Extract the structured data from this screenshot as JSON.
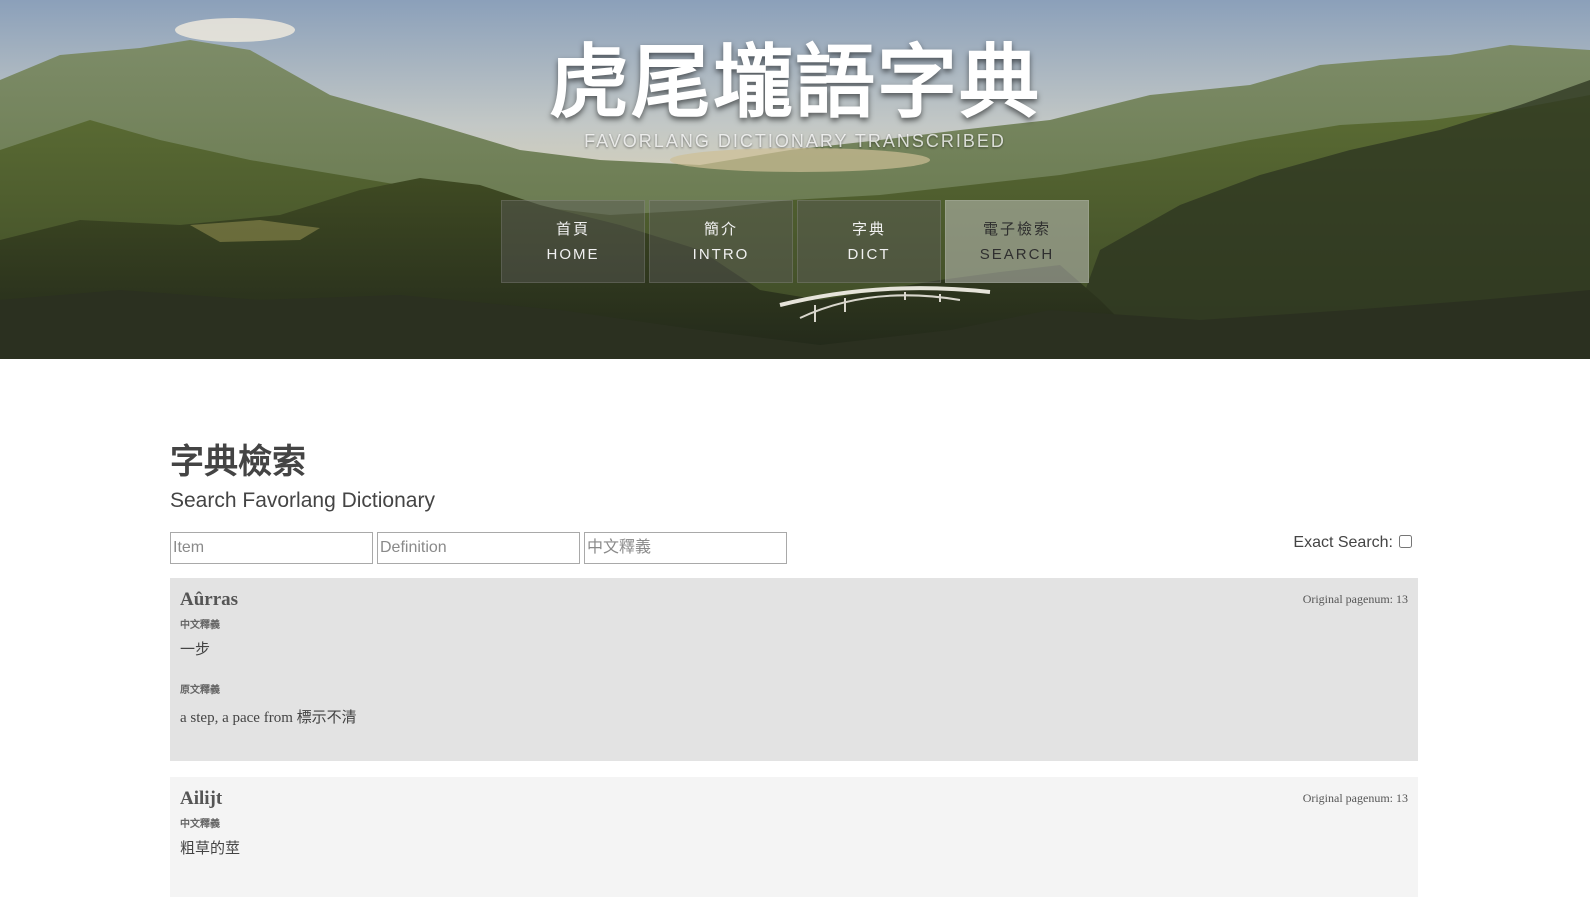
{
  "site": {
    "title": "虎尾壠語字典",
    "subtitle": "FAVORLANG DICTIONARY TRANSCRIBED"
  },
  "nav": [
    {
      "zh": "首頁",
      "en": "HOME",
      "active": false
    },
    {
      "zh": "簡介",
      "en": "INTRO",
      "active": false
    },
    {
      "zh": "字典",
      "en": "DICT",
      "active": false
    },
    {
      "zh": "電子檢索",
      "en": "SEARCH",
      "active": true
    }
  ],
  "page": {
    "title": "字典檢索",
    "subtitle": "Search Favorlang Dictionary"
  },
  "search": {
    "item_placeholder": "Item",
    "definition_placeholder": "Definition",
    "chinese_placeholder": "中文釋義",
    "exact_label": "Exact Search:",
    "exact_checked": false
  },
  "entries": [
    {
      "word": "Aûrras",
      "page": "Original pagenum: 13",
      "chinese_label": "中文釋義",
      "chinese": "一步",
      "original_label": "原文釋義",
      "original": "a step, a pace from 標示不清"
    },
    {
      "word": "Ailijt",
      "page": "Original pagenum: 13",
      "chinese_label": "中文釋義",
      "chinese": "粗草的莖"
    }
  ],
  "colors": {
    "entry_odd_bg": "#e3e3e3",
    "entry_even_bg": "#f4f4f4",
    "nav_active_bg": "#bfc0ba",
    "text": "#444444"
  }
}
